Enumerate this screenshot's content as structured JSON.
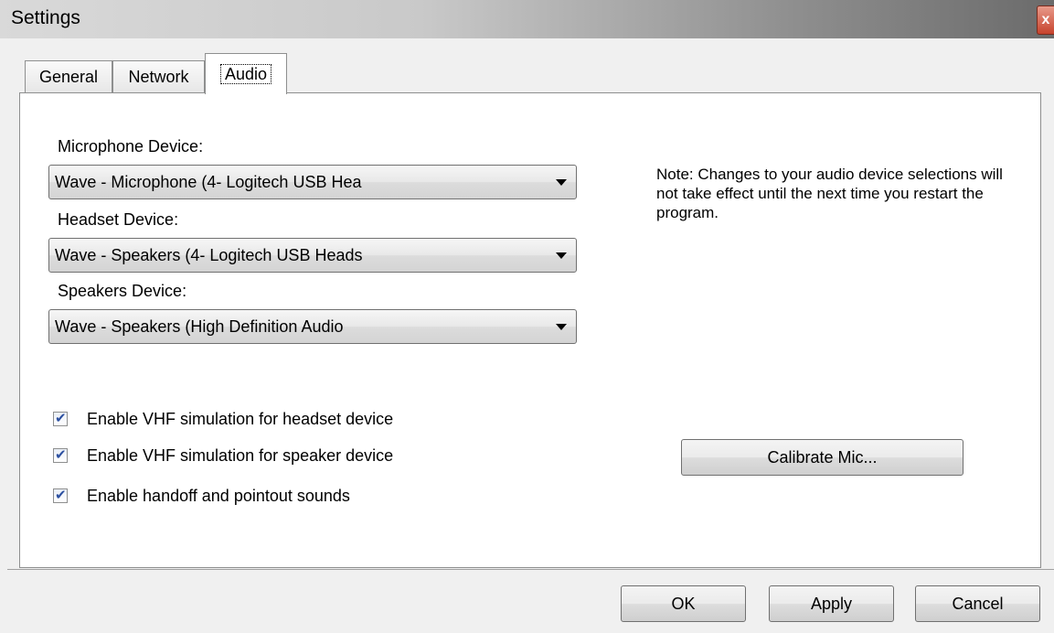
{
  "window": {
    "title": "Settings",
    "close_glyph": "x"
  },
  "tabs": [
    {
      "label": "General",
      "active": false
    },
    {
      "label": "Network",
      "active": false
    },
    {
      "label": "Audio",
      "active": true
    }
  ],
  "audio": {
    "microphone": {
      "label": "Microphone Device:",
      "value": "Wave - Microphone (4- Logitech USB Hea"
    },
    "headset": {
      "label": "Headset Device:",
      "value": "Wave - Speakers (4- Logitech USB Heads"
    },
    "speakers": {
      "label": "Speakers Device:",
      "value": "Wave - Speakers (High Definition Audio"
    },
    "note": "Note: Changes to your audio device selections will not take effect until the next time you restart the program.",
    "checkboxes": [
      {
        "label": "Enable VHF simulation for headset device",
        "checked": true
      },
      {
        "label": "Enable VHF simulation for speaker device",
        "checked": true
      },
      {
        "label": "Enable handoff and pointout sounds",
        "checked": true
      }
    ],
    "calibrate_label": "Calibrate Mic..."
  },
  "buttons": {
    "ok": "OK",
    "apply": "Apply",
    "cancel": "Cancel"
  },
  "icons": {
    "dropdown": "chevron-down-icon",
    "check": "checkmark-icon",
    "close": "close-icon"
  }
}
